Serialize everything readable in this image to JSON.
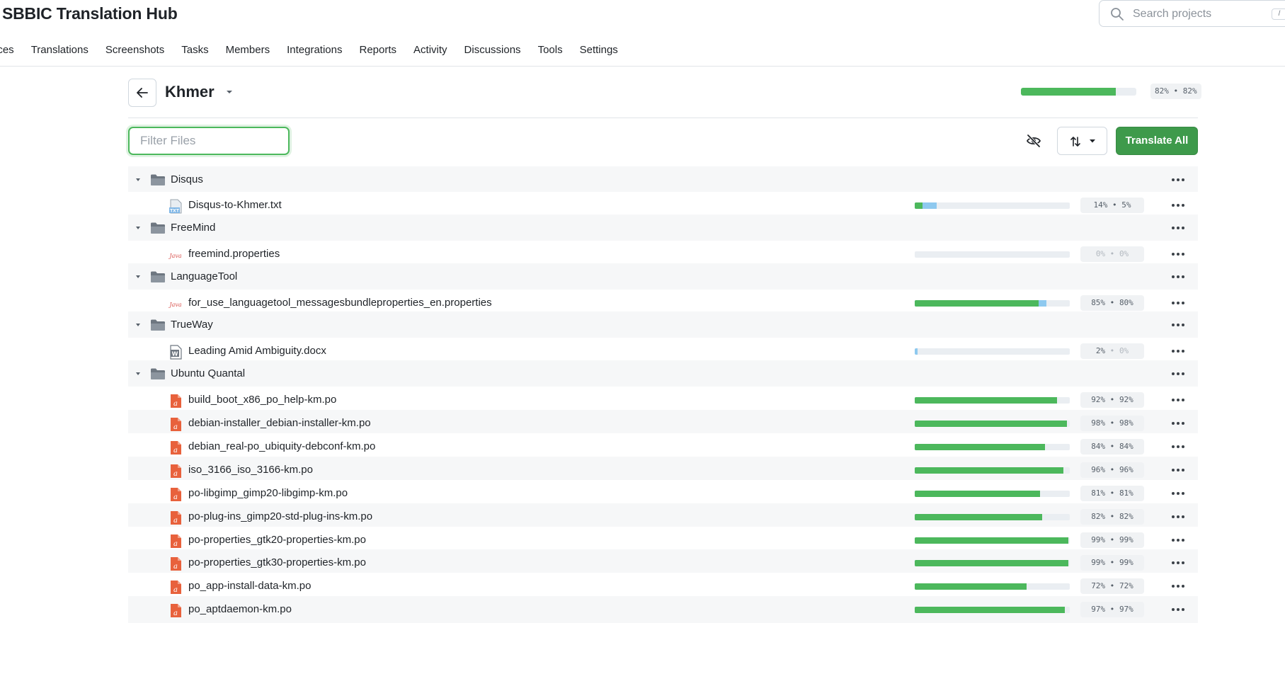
{
  "header": {
    "app_title": "SBBIC Translation Hub",
    "search_placeholder": "Search projects",
    "search_shortcut": "/"
  },
  "nav": {
    "items": [
      "urces",
      "Translations",
      "Screenshots",
      "Tasks",
      "Members",
      "Integrations",
      "Reports",
      "Activity",
      "Discussions",
      "Tools",
      "Settings"
    ]
  },
  "language": {
    "name": "Khmer",
    "progress_label": "82% • 82%",
    "approved_fraction": 0.82,
    "translated_fraction": 0.82
  },
  "toolbar": {
    "filter_placeholder": "Filter Files",
    "translate_all_label": "Translate All"
  },
  "colors": {
    "approved": "#4cb85c",
    "translated": "#8ec9ef",
    "primary_button": "#3e9a4b"
  },
  "tree": {
    "rows": [
      {
        "kind": "folder",
        "name": "Disqus"
      },
      {
        "kind": "file",
        "icon": "txt-file-icon",
        "name": "Disqus-to-Khmer.txt",
        "translated": 0.14,
        "approved": 0.05,
        "pct_translated": "14%",
        "pct_approved": "5%",
        "approved_muted": false
      },
      {
        "kind": "folder",
        "name": "FreeMind"
      },
      {
        "kind": "file",
        "icon": "java-file-icon",
        "name": "freemind.properties",
        "translated": 0.0,
        "approved": 0.0,
        "pct_translated": "0%",
        "pct_approved": "0%",
        "translated_muted": true,
        "approved_muted": true
      },
      {
        "kind": "folder",
        "name": "LanguageTool"
      },
      {
        "kind": "file",
        "icon": "java-file-icon",
        "name": "for_use_languagetool_messagesbundleproperties_en.properties",
        "translated": 0.85,
        "approved": 0.8,
        "pct_translated": "85%",
        "pct_approved": "80%",
        "approved_muted": false
      },
      {
        "kind": "folder",
        "name": "TrueWay"
      },
      {
        "kind": "file",
        "icon": "docx-file-icon",
        "name": "Leading Amid Ambiguity.docx",
        "translated": 0.02,
        "approved": 0.0,
        "pct_translated": "2%",
        "pct_approved": "0%",
        "approved_muted": true
      },
      {
        "kind": "folder",
        "name": "Ubuntu Quantal"
      },
      {
        "kind": "file",
        "icon": "po-file-icon",
        "name": "build_boot_x86_po_help-km.po",
        "translated": 0.92,
        "approved": 0.92,
        "pct_translated": "92%",
        "pct_approved": "92%"
      },
      {
        "kind": "file",
        "icon": "po-file-icon",
        "name": "debian-installer_debian-installer-km.po",
        "translated": 0.98,
        "approved": 0.98,
        "pct_translated": "98%",
        "pct_approved": "98%",
        "alt": true
      },
      {
        "kind": "file",
        "icon": "po-file-icon",
        "name": "debian_real-po_ubiquity-debconf-km.po",
        "translated": 0.84,
        "approved": 0.84,
        "pct_translated": "84%",
        "pct_approved": "84%"
      },
      {
        "kind": "file",
        "icon": "po-file-icon",
        "name": "iso_3166_iso_3166-km.po",
        "translated": 0.96,
        "approved": 0.96,
        "pct_translated": "96%",
        "pct_approved": "96%",
        "alt": true
      },
      {
        "kind": "file",
        "icon": "po-file-icon",
        "name": "po-libgimp_gimp20-libgimp-km.po",
        "translated": 0.81,
        "approved": 0.81,
        "pct_translated": "81%",
        "pct_approved": "81%"
      },
      {
        "kind": "file",
        "icon": "po-file-icon",
        "name": "po-plug-ins_gimp20-std-plug-ins-km.po",
        "translated": 0.82,
        "approved": 0.82,
        "pct_translated": "82%",
        "pct_approved": "82%",
        "alt": true
      },
      {
        "kind": "file",
        "icon": "po-file-icon",
        "name": "po-properties_gtk20-properties-km.po",
        "translated": 0.99,
        "approved": 0.99,
        "pct_translated": "99%",
        "pct_approved": "99%"
      },
      {
        "kind": "file",
        "icon": "po-file-icon",
        "name": "po-properties_gtk30-properties-km.po",
        "translated": 0.99,
        "approved": 0.99,
        "pct_translated": "99%",
        "pct_approved": "99%",
        "alt": true
      },
      {
        "kind": "file",
        "icon": "po-file-icon",
        "name": "po_app-install-data-km.po",
        "translated": 0.72,
        "approved": 0.72,
        "pct_translated": "72%",
        "pct_approved": "72%"
      },
      {
        "kind": "file",
        "icon": "po-file-icon",
        "name": "po_aptdaemon-km.po",
        "translated": 0.97,
        "approved": 0.97,
        "pct_translated": "97%",
        "pct_approved": "97%",
        "alt": true
      }
    ]
  }
}
